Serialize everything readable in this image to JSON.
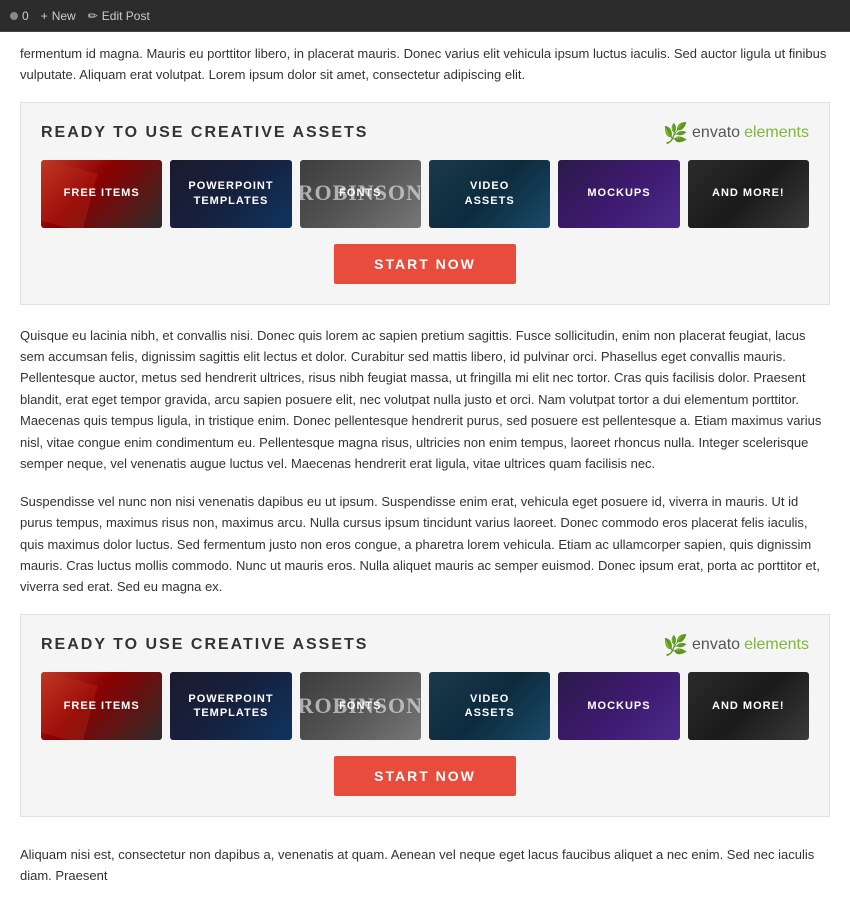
{
  "topbar": {
    "counter": "0",
    "new_label": "New",
    "edit_label": "Edit Post"
  },
  "intro_text": "fermentum id magna. Mauris eu porttitor libero, in placerat mauris. Donec varius elit vehicula ipsum luctus iaculis. Sed auctor ligula ut finibus vulputate. Aliquam erat volutpat. Lorem ipsum dolor sit amet, consectetur adipiscing elit.",
  "block1": {
    "title": "READY TO USE CREATIVE ASSETS",
    "envato": "envato",
    "elements": "elements",
    "cards": [
      {
        "id": "free-items",
        "label": "FREE ITEMS",
        "type": "free-items"
      },
      {
        "id": "powerpoint",
        "label": "POWERPOINT\nTEMPLATES",
        "type": "powerpoint"
      },
      {
        "id": "fonts",
        "label": "FONTS",
        "type": "fonts"
      },
      {
        "id": "video",
        "label": "VIDEO\nASSETS",
        "type": "video"
      },
      {
        "id": "mockups",
        "label": "MOCKUPS",
        "type": "mockups"
      },
      {
        "id": "more",
        "label": "AND MORE!",
        "type": "more"
      }
    ],
    "button_label": "START NOW"
  },
  "paragraph1": "Quisque eu lacinia nibh, et convallis nisi. Donec quis lorem ac sapien pretium sagittis. Fusce sollicitudin, enim non placerat feugiat, lacus sem accumsan felis, dignissim sagittis elit lectus et dolor. Curabitur sed mattis libero, id pulvinar orci. Phasellus eget convallis mauris. Pellentesque auctor, metus sed hendrerit ultrices, risus nibh feugiat massa, ut fringilla mi elit nec tortor. Cras quis facilisis dolor. Praesent blandit, erat eget tempor gravida, arcu sapien posuere elit, nec volutpat nulla justo et orci. Nam volutpat tortor a dui elementum porttitor. Maecenas quis tempus ligula, in tristique enim. Donec pellentesque hendrerit purus, sed posuere est pellentesque a. Etiam maximus varius nisl, vitae congue enim condimentum eu. Pellentesque magna risus, ultricies non enim tempus, laoreet rhoncus nulla. Integer scelerisque semper neque, vel venenatis augue luctus vel. Maecenas hendrerit erat ligula, vitae ultrices quam facilisis nec.",
  "paragraph2": "Suspendisse vel nunc non nisi venenatis dapibus eu ut ipsum. Suspendisse enim erat, vehicula eget posuere id, viverra in mauris. Ut id purus tempus, maximus risus non, maximus arcu. Nulla cursus ipsum tincidunt varius laoreet. Donec commodo eros placerat felis iaculis, quis maximus dolor luctus. Sed fermentum justo non eros congue, a pharetra lorem vehicula. Etiam ac ullamcorper sapien, quis dignissim mauris. Cras luctus mollis commodo. Nunc ut mauris eros. Nulla aliquet mauris ac semper euismod. Donec ipsum erat, porta ac porttitor et, viverra sed erat. Sed eu magna ex.",
  "block2": {
    "title": "READY TO USE CREATIVE ASSETS",
    "envato": "envato",
    "elements": "elements",
    "cards": [
      {
        "id": "free-items2",
        "label": "FREE ITEMS",
        "type": "free-items"
      },
      {
        "id": "powerpoint2",
        "label": "POWERPOINT\nTEMPLATES",
        "type": "powerpoint"
      },
      {
        "id": "fonts2",
        "label": "FONTS",
        "type": "fonts"
      },
      {
        "id": "video2",
        "label": "VIDEO\nASSETS",
        "type": "video"
      },
      {
        "id": "mockups2",
        "label": "MOCKUPS",
        "type": "mockups"
      },
      {
        "id": "more2",
        "label": "AND MORE!",
        "type": "more"
      }
    ],
    "button_label": "START NOW"
  },
  "footer_text": "Aliquam nisi est, consectetur non dapibus a, venenatis at quam. Aenean vel neque eget lacus faucibus aliquet a nec enim. Sed nec iaculis diam. Praesent"
}
